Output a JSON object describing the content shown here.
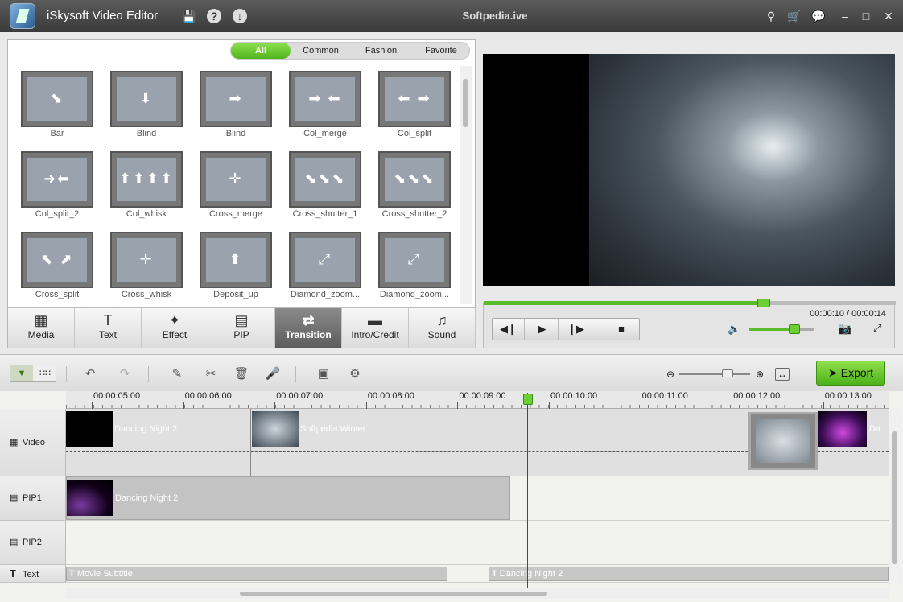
{
  "app": {
    "title": "iSkysoft Video Editor",
    "window_title": "Softpedia.ive"
  },
  "titlebar_icons": [
    "save-icon",
    "help-icon",
    "download-icon"
  ],
  "window_icons": [
    "key-icon",
    "cart-icon",
    "chat-icon",
    "minimize-icon",
    "maximize-icon",
    "close-icon"
  ],
  "filter_tabs": [
    {
      "label": "All",
      "active": true
    },
    {
      "label": "Common",
      "active": false
    },
    {
      "label": "Fashion",
      "active": false
    },
    {
      "label": "Favorite",
      "active": false
    }
  ],
  "transitions": [
    {
      "label": "Bar",
      "arrows": "⬊"
    },
    {
      "label": "Blind",
      "arrows": "⬇"
    },
    {
      "label": "Blind",
      "arrows": "➡"
    },
    {
      "label": "Col_merge",
      "arrows": "➡ ⬅"
    },
    {
      "label": "Col_split",
      "arrows": "⬅ ➡"
    },
    {
      "label": "Col_split_2",
      "arrows": "➜⬅"
    },
    {
      "label": "Col_whisk",
      "arrows": "⬆⬆⬆⬆"
    },
    {
      "label": "Cross_merge",
      "arrows": "✛"
    },
    {
      "label": "Cross_shutter_1",
      "arrows": "⬊⬊⬊"
    },
    {
      "label": "Cross_shutter_2",
      "arrows": "⬊⬊⬊"
    },
    {
      "label": "Cross_split",
      "arrows": "⬉ ⬈"
    },
    {
      "label": "Cross_whisk",
      "arrows": "✛"
    },
    {
      "label": "Deposit_up",
      "arrows": "⬆"
    },
    {
      "label": "Diamond_zoom...",
      "arrows": "⤢"
    },
    {
      "label": "Diamond_zoom...",
      "arrows": "⤢"
    }
  ],
  "media_tabs": [
    {
      "label": "Media",
      "icon": "media-icon",
      "glyph": "▦",
      "active": false
    },
    {
      "label": "Text",
      "icon": "text-icon",
      "glyph": "T",
      "active": false
    },
    {
      "label": "Effect",
      "icon": "magic-wand-icon",
      "glyph": "✦",
      "active": false
    },
    {
      "label": "PIP",
      "icon": "pip-icon",
      "glyph": "▤",
      "active": false
    },
    {
      "label": "Transition",
      "icon": "transition-icon",
      "glyph": "⇄",
      "active": true
    },
    {
      "label": "Intro/Credit",
      "icon": "clapper-icon",
      "glyph": "▬",
      "active": false
    },
    {
      "label": "Sound",
      "icon": "headphones-icon",
      "glyph": "♫",
      "active": false
    }
  ],
  "player": {
    "time": "00:00:10 / 00:00:14",
    "progress": 0.68,
    "volume": 0.7
  },
  "toolbar": {
    "export_label": "Export",
    "zoom_level": 0.68
  },
  "timeline": {
    "ruler": [
      "00:00:05:00",
      "00:00:06:00",
      "00:00:07:00",
      "00:00:08:00",
      "00:00:09:00",
      "00:00:10:00",
      "00:00:11:00",
      "00:00:12:00",
      "00:00:13:00"
    ],
    "tracks": [
      {
        "label": "Video"
      },
      {
        "label": "PIP1"
      },
      {
        "label": "PIP2"
      },
      {
        "label": "Text"
      }
    ],
    "video_clips": [
      "Dancing Night 2",
      "Softpedia Winter",
      "Da..."
    ],
    "pip1_clips": [
      "Dancing Night 2"
    ],
    "text_clips": [
      "Movie Subtitle",
      "Dancing Night 2"
    ]
  },
  "colors": {
    "accent": "#5bbb2a",
    "playhead": "#d01010"
  }
}
